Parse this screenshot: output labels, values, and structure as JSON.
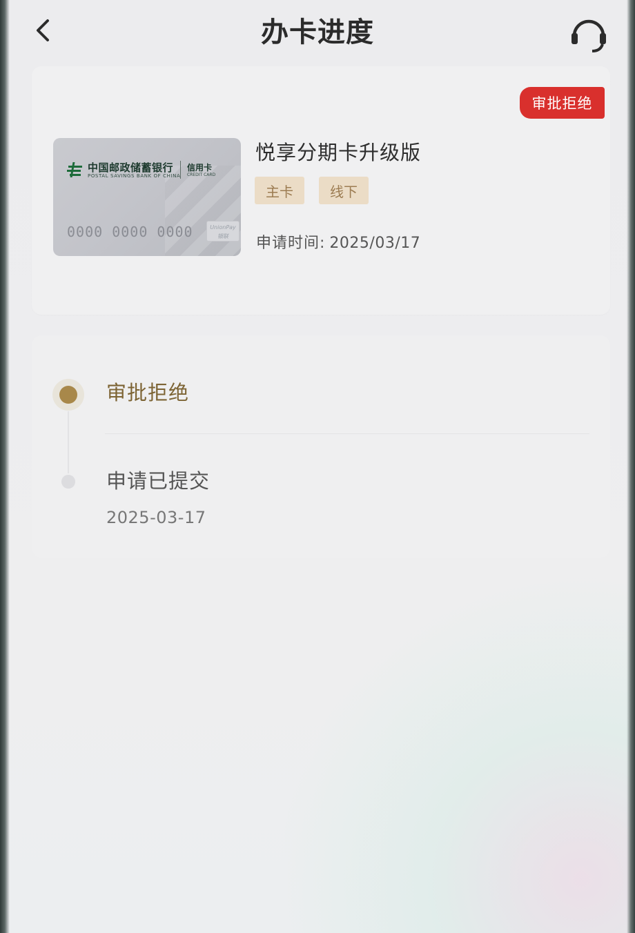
{
  "header": {
    "title": "办卡进度",
    "back_icon": "chevron-left-icon",
    "service_icon": "headset-icon"
  },
  "application": {
    "status_tag": "审批拒绝",
    "product_name": "悦享分期卡升级版",
    "tags": [
      "主卡",
      "线下"
    ],
    "apply_time_label": "申请时间:",
    "apply_time_value": "2025/03/17",
    "card": {
      "bank_name_cn": "中国邮政储蓄银行",
      "bank_name_en": "POSTAL SAVINGS BANK OF CHINA",
      "card_type_cn": "信用卡",
      "card_type_en": "CREDIT CARD",
      "card_number": "0000 0000 0000",
      "network": "UnionPay 银联"
    }
  },
  "progress": {
    "steps": [
      {
        "title": "审批拒绝",
        "date": "",
        "active": true
      },
      {
        "title": "申请已提交",
        "date": "2025-03-17",
        "active": false
      }
    ]
  },
  "colors": {
    "status_red": "#d9302d",
    "active_gold": "#a8884a",
    "chip_bg": "#ebdcc6",
    "chip_text": "#9c7c52"
  }
}
